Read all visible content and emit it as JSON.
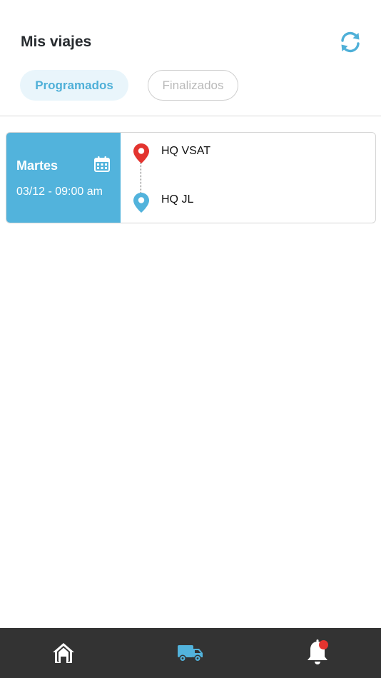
{
  "header": {
    "title": "Mis viajes",
    "refresh_icon": "refresh-icon"
  },
  "tabs": [
    {
      "label": "Programados",
      "active": true
    },
    {
      "label": "Finalizados",
      "active": false
    }
  ],
  "trips": [
    {
      "day": "Martes",
      "datetime": "03/12 - 09:00 am",
      "origin": "HQ VSAT",
      "destination": "HQ JL"
    }
  ],
  "bottom_nav": {
    "items": [
      {
        "icon": "home-icon",
        "active": false
      },
      {
        "icon": "truck-icon",
        "active": true
      },
      {
        "icon": "bell-icon",
        "active": false,
        "has_badge": true
      }
    ]
  },
  "colors": {
    "accent": "#52b3dc",
    "origin_pin": "#e3342f",
    "destination_pin": "#52b3dc",
    "nav_background": "#333333",
    "badge": "#e3342f"
  }
}
